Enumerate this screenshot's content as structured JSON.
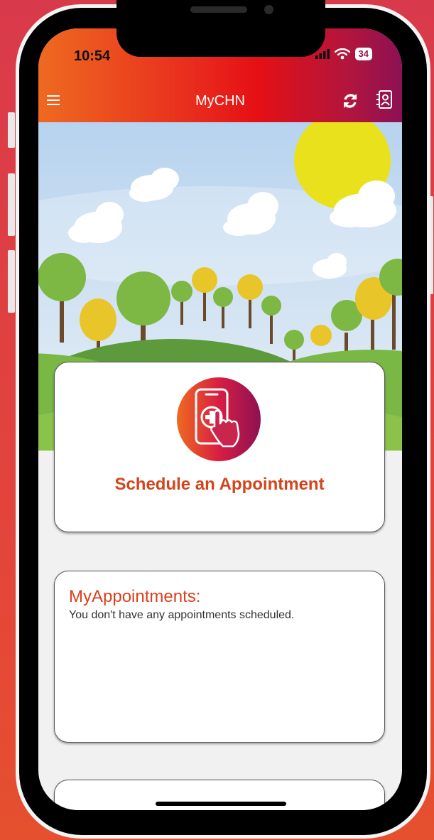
{
  "status_bar": {
    "time": "10:54",
    "battery": "34"
  },
  "app_bar": {
    "title": "MyCHN",
    "menu_icon": "hamburger-menu-icon",
    "refresh_icon": "refresh-icon",
    "contact_icon": "contact-card-icon"
  },
  "schedule_card": {
    "label": "Schedule an Appointment",
    "icon": "phone-tap-plus-icon"
  },
  "appointments_card": {
    "title": "MyAppointments:",
    "empty_message": "You don't have any appointments scheduled."
  },
  "colors": {
    "gradient_start": "#ee6a20",
    "gradient_mid": "#e51014",
    "gradient_end": "#8c1154",
    "accent_text": "#d2451c"
  }
}
